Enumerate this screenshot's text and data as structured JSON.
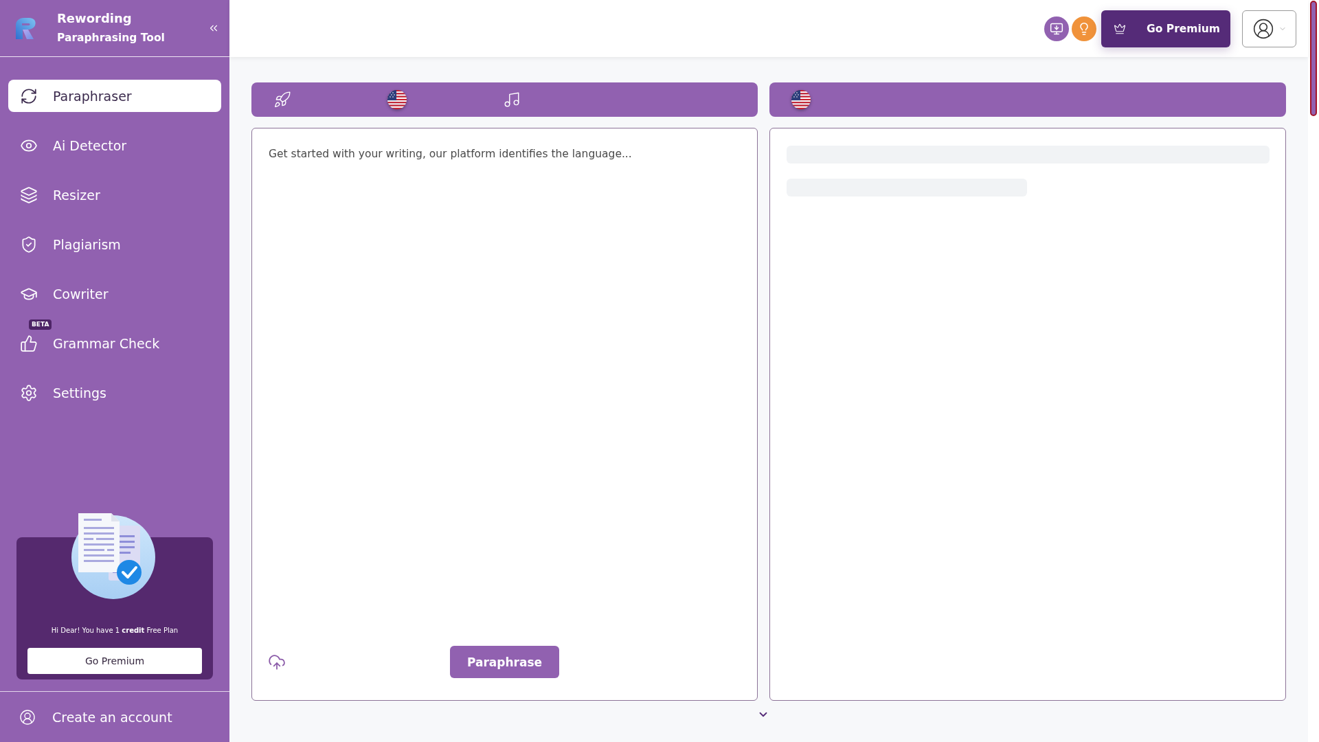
{
  "sidebar": {
    "brand": {
      "title": "Rewording",
      "subtitle": "Paraphrasing Tool"
    },
    "nav": [
      {
        "label": "Paraphraser",
        "selected": true
      },
      {
        "label": "Ai Detector",
        "selected": false
      },
      {
        "label": "Resizer",
        "selected": false
      },
      {
        "label": "Plagiarism",
        "selected": false
      },
      {
        "label": "Cowriter",
        "selected": false
      },
      {
        "label": "Grammar Check",
        "selected": false,
        "badge": "BETA"
      },
      {
        "label": "Settings",
        "selected": false
      }
    ],
    "promo": {
      "message": "Hi Dear! You have 1 **credit** Free Plan",
      "button": "Go Premium"
    },
    "footer": {
      "label": "Create an account"
    }
  },
  "header": {
    "premium_button": "Go Premium"
  },
  "editor": {
    "input": {
      "placeholder": "Get started with your writing, our platform identifies the language..."
    },
    "action_button": "Paraphrase"
  },
  "output": {
    "loading": true
  }
}
